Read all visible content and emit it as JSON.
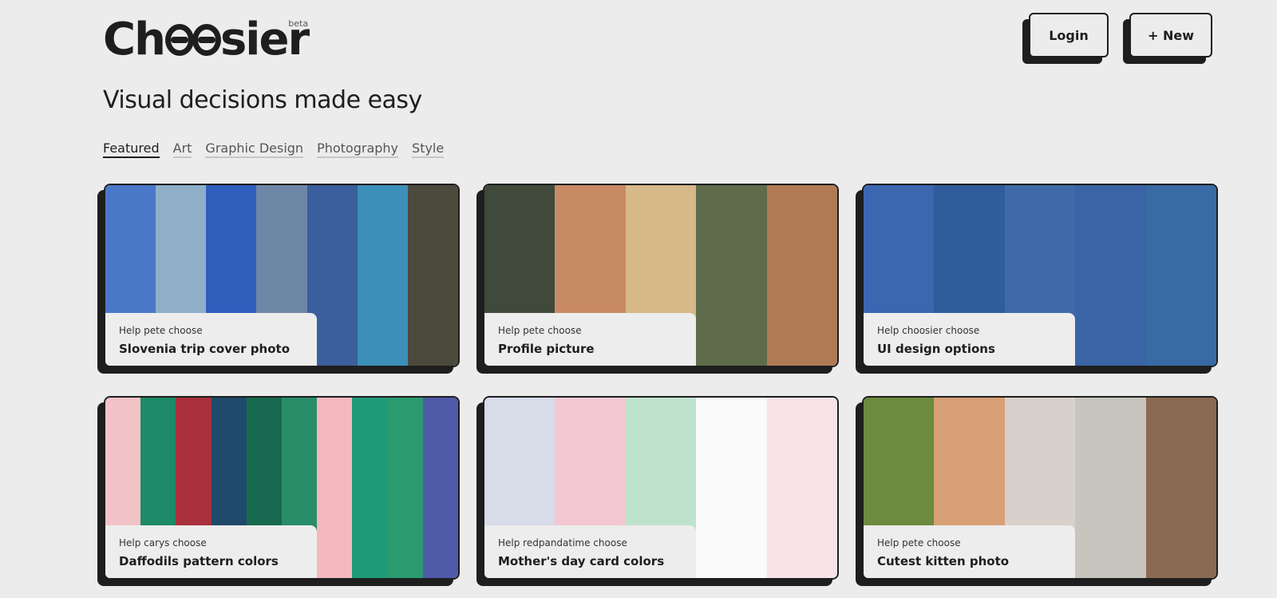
{
  "header": {
    "logo_text_start": "Ch",
    "logo_text_end": "sier",
    "beta_label": "beta",
    "login_label": "Login",
    "new_label": "+ New"
  },
  "tagline": "Visual decisions made easy",
  "tabs": [
    {
      "label": "Featured",
      "active": true
    },
    {
      "label": "Art",
      "active": false
    },
    {
      "label": "Graphic Design",
      "active": false
    },
    {
      "label": "Photography",
      "active": false
    },
    {
      "label": "Style",
      "active": false
    }
  ],
  "cards": [
    {
      "subtitle": "Help pete choose",
      "title": "Slovenia trip cover photo",
      "strips": [
        "#4a78c8",
        "#8faec8",
        "#2f5fbd",
        "#6f87a6",
        "#3a5f9c",
        "#3c8fb8",
        "#4b4a3c"
      ]
    },
    {
      "subtitle": "Help pete choose",
      "title": "Profile picture",
      "strips": [
        "#3f4a3a",
        "#c98a66",
        "#d7b889",
        "#5f6c4c",
        "#b07a55"
      ]
    },
    {
      "subtitle": "Help choosier choose",
      "title": "UI design options",
      "strips": [
        "#3b66b0",
        "#2f5c9a",
        "#3f6aa8",
        "#3a64a6",
        "#386aa4"
      ]
    },
    {
      "subtitle": "Help carys choose",
      "title": "Daffodils pattern colors",
      "strips": [
        "#f2c3c6",
        "#1e8a67",
        "#a8303c",
        "#1f4a6b",
        "#176a4f",
        "#2a8d6a",
        "#f4b8bf",
        "#1f9b78",
        "#2c9a6f",
        "#4f5aa8"
      ]
    },
    {
      "subtitle": "Help redpandatime choose",
      "title": "Mother's day card colors",
      "strips": [
        "#d8dbe8",
        "#f3c7d3",
        "#bfe2cd",
        "#fafafa",
        "#f7e3e7"
      ]
    },
    {
      "subtitle": "Help pete choose",
      "title": "Cutest kitten photo",
      "strips": [
        "#6d8a3e",
        "#d8a076",
        "#d8d0cb",
        "#c8c4be",
        "#8a6a52"
      ]
    }
  ]
}
